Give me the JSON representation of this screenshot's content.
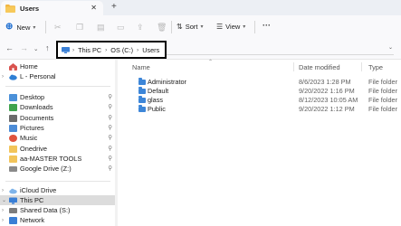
{
  "tab": {
    "title": "Users",
    "close": "✕",
    "new_tab": "+"
  },
  "toolbar": {
    "new_label": "New",
    "sort_label": "Sort",
    "view_label": "View",
    "more": "···"
  },
  "address": {
    "crumbs": [
      "This PC",
      "OS (C:)",
      "Users"
    ]
  },
  "sidebar": {
    "top_items": [
      {
        "label": "Home",
        "icon": "home-icon"
      },
      {
        "label": "L - Personal",
        "icon": "cloud-icon"
      }
    ],
    "pinned_items": [
      {
        "label": "Desktop",
        "icon": "desktop-icon",
        "color": "#4a90d9"
      },
      {
        "label": "Downloads",
        "icon": "download-icon",
        "color": "#3fa34d"
      },
      {
        "label": "Documents",
        "icon": "document-icon",
        "color": "#6b6b6b"
      },
      {
        "label": "Pictures",
        "icon": "pictures-icon",
        "color": "#4b8bd6"
      },
      {
        "label": "Music",
        "icon": "music-icon",
        "color": "#e0533d"
      },
      {
        "label": "Onedrive",
        "icon": "folder-icon",
        "color": "#f2c45a"
      },
      {
        "label": "aa-MASTER TOOLS",
        "icon": "folder-icon",
        "color": "#f2c45a"
      },
      {
        "label": "Google Drive (Z:)",
        "icon": "drive-icon",
        "color": "#8a8a8a"
      }
    ],
    "bottom_items": [
      {
        "label": "iCloud Drive",
        "icon": "icloud-icon"
      },
      {
        "label": "This PC",
        "icon": "pc-icon"
      },
      {
        "label": "Shared Data (S:)",
        "icon": "network-drive-icon"
      },
      {
        "label": "Network",
        "icon": "network-icon"
      }
    ]
  },
  "columns": {
    "name": "Name",
    "date": "Date modified",
    "type": "Type"
  },
  "rows": [
    {
      "name": "Administrator",
      "date": "8/6/2023 1:28 PM",
      "type": "File folder"
    },
    {
      "name": "Default",
      "date": "9/20/2022 1:16 PM",
      "type": "File folder"
    },
    {
      "name": "glass",
      "date": "8/12/2023 10:05 AM",
      "type": "File folder"
    },
    {
      "name": "Public",
      "date": "9/20/2022 1:12 PM",
      "type": "File folder"
    }
  ],
  "colors": {
    "accent": "#1f6fd1",
    "folder": "#3d86d8",
    "selected_bg": "#dcdcdc"
  }
}
